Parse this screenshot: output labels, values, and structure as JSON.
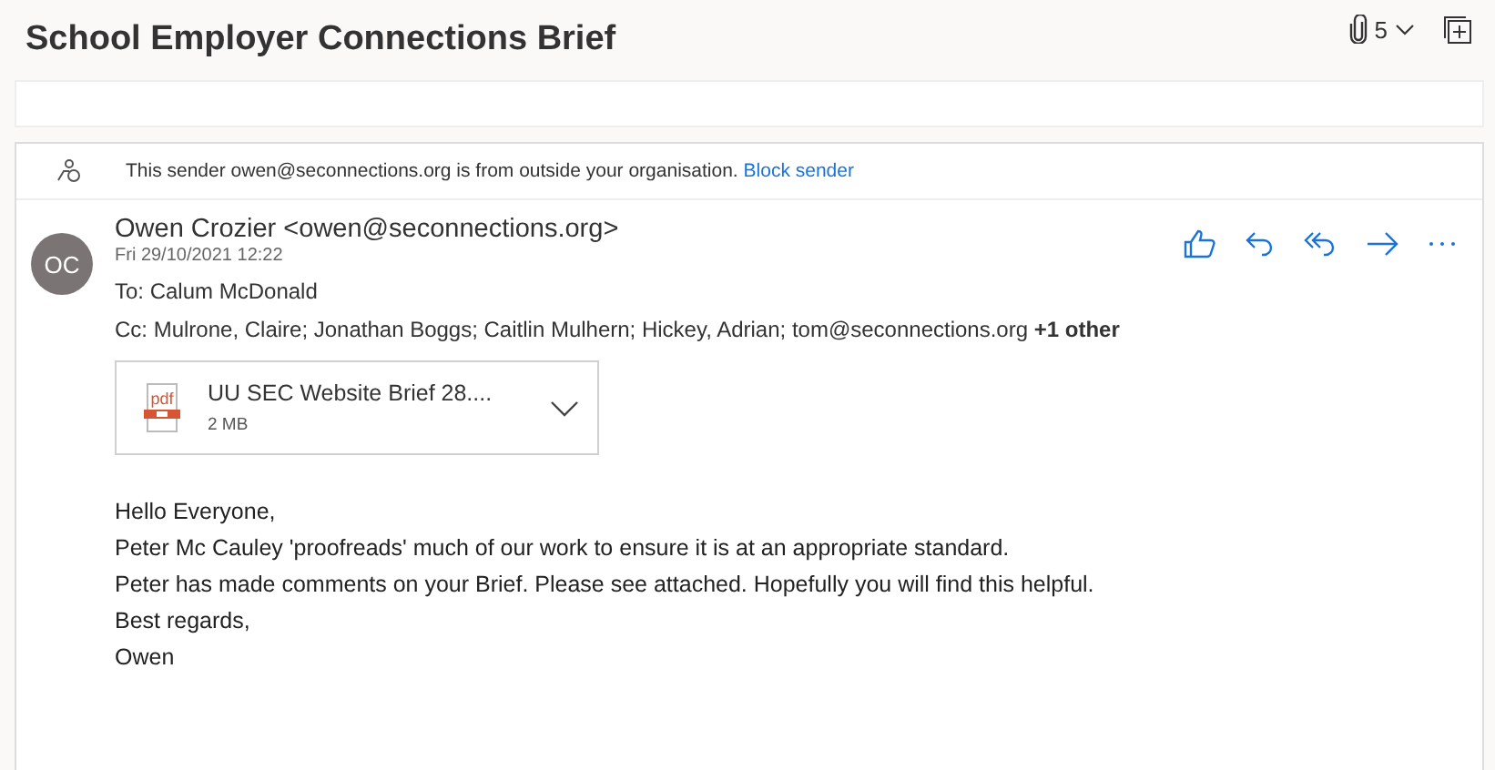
{
  "subject": "School Employer Connections Brief",
  "attachment_count": "5",
  "external_warning": {
    "text": "This sender owen@seconnections.org is from outside your organisation.",
    "link": "Block sender"
  },
  "message": {
    "avatar_initials": "OC",
    "from": "Owen Crozier <owen@seconnections.org>",
    "date": "Fri 29/10/2021 12:22",
    "to": "To:  Calum McDonald",
    "cc": "Cc:  Mulrone, Claire; Jonathan Boggs; Caitlin Mulhern; Hickey, Adrian; tom@seconnections.org **+1 other**",
    "attachment": {
      "name": "UU SEC Website Brief 28....",
      "size": "2 MB",
      "file_label": "pdf"
    },
    "body": [
      "Hello Everyone,",
      "Peter Mc Cauley 'proofreads' much of our work to ensure it is at an appropriate standard.",
      "Peter has made comments on your Brief. Please see attached. Hopefully you will find this helpful.",
      "Best regards,",
      "Owen"
    ]
  }
}
